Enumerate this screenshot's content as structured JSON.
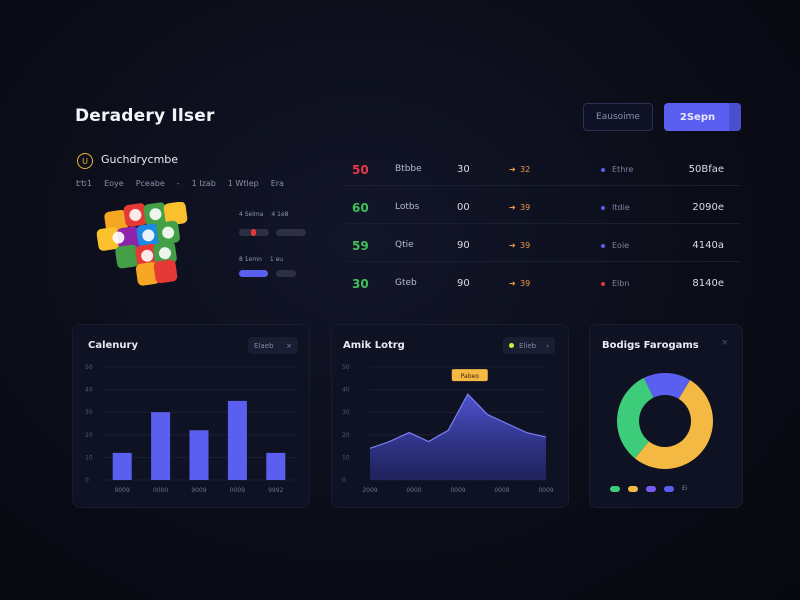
{
  "header": {
    "title": "Deradery Ilser",
    "secondary_button": "Eausoime",
    "primary_button": "2Sepn"
  },
  "profile": {
    "badge_glyph": "U",
    "name": "Guchdrycmbe",
    "meta": [
      "ԷԵ1",
      "Eoye",
      "Pceabe",
      "-",
      "1 Izab",
      "1 Wtlep",
      "Era"
    ],
    "app_icon_colors": [
      "#f5a623",
      "#e53935",
      "#43a047",
      "#1e88e5",
      "#fbc02d",
      "#8e24aa"
    ],
    "stats": [
      {
        "label": "4 Selma",
        "label2": "4 1e8"
      },
      {
        "label": "8 1emn",
        "label2": "1 eu"
      }
    ]
  },
  "table": {
    "rows": [
      {
        "score": "50",
        "score_color": "#e53947",
        "name": "Btbbe",
        "value": "30",
        "arrow_color": "#f2994a",
        "change": "32",
        "dot_color": "#5b5ff0",
        "small": "Ethre",
        "right": "50Bfae"
      },
      {
        "score": "60",
        "score_color": "#3fc15a",
        "name": "Lotbs",
        "value": "00",
        "arrow_color": "#f2994a",
        "change": "39",
        "dot_color": "#5b5ff0",
        "small": "Itdie",
        "right": "2090e"
      },
      {
        "score": "59",
        "score_color": "#3fc15a",
        "name": "Qtie",
        "value": "90",
        "arrow_color": "#f2994a",
        "change": "39",
        "dot_color": "#5b5ff0",
        "small": "Eoie",
        "right": "4140a"
      },
      {
        "score": "30",
        "score_color": "#3fc15a",
        "name": "Gteb",
        "value": "90",
        "arrow_color": "#f2994a",
        "change": "39",
        "dot_color": "#e53935",
        "small": "Elbn",
        "right": "8140e"
      }
    ]
  },
  "cards": {
    "bar": {
      "title": "Calenury",
      "control": "Elaeb"
    },
    "area": {
      "title": "Amik Lotrg",
      "control": "Elieb",
      "tooltip": "Pabeo"
    },
    "donut": {
      "title": "Bodigs Farogams"
    }
  },
  "chart_data": [
    {
      "type": "bar",
      "title": "Calenury",
      "categories": [
        "9009",
        "0000",
        "9009",
        "0009",
        "9992"
      ],
      "values": [
        12,
        30,
        22,
        35,
        12
      ],
      "yticks": [
        "0",
        "10",
        "20",
        "30",
        "40",
        "50"
      ],
      "ylim": [
        0,
        50
      ],
      "color": "#5b5ff0"
    },
    {
      "type": "area",
      "title": "Amik Lotrg",
      "categories": [
        "2009",
        "0000",
        "0009",
        "0009",
        "0009"
      ],
      "x": [
        0,
        1,
        2,
        3,
        4,
        5,
        6,
        7,
        8,
        9
      ],
      "values": [
        14,
        17,
        21,
        17,
        22,
        38,
        29,
        25,
        21,
        19
      ],
      "yticks": [
        "0",
        "10",
        "20",
        "30",
        "40",
        "50"
      ],
      "ylim": [
        0,
        50
      ],
      "color": "#5b5ff0"
    },
    {
      "type": "pie",
      "title": "Bodigs Farogams",
      "series": [
        {
          "name": "",
          "value": 52,
          "color": "#f4b942"
        },
        {
          "name": "",
          "value": 32,
          "color": "#3dcc7a"
        },
        {
          "name": "",
          "value": 16,
          "color": "#5b5ff0"
        }
      ],
      "legend": [
        {
          "label": "",
          "color": "#3dcc7a"
        },
        {
          "label": "",
          "color": "#f4b942"
        },
        {
          "label": "",
          "color": "#7a5cf0"
        },
        {
          "label": "Ei",
          "color": "#5b5ff0"
        }
      ]
    }
  ]
}
